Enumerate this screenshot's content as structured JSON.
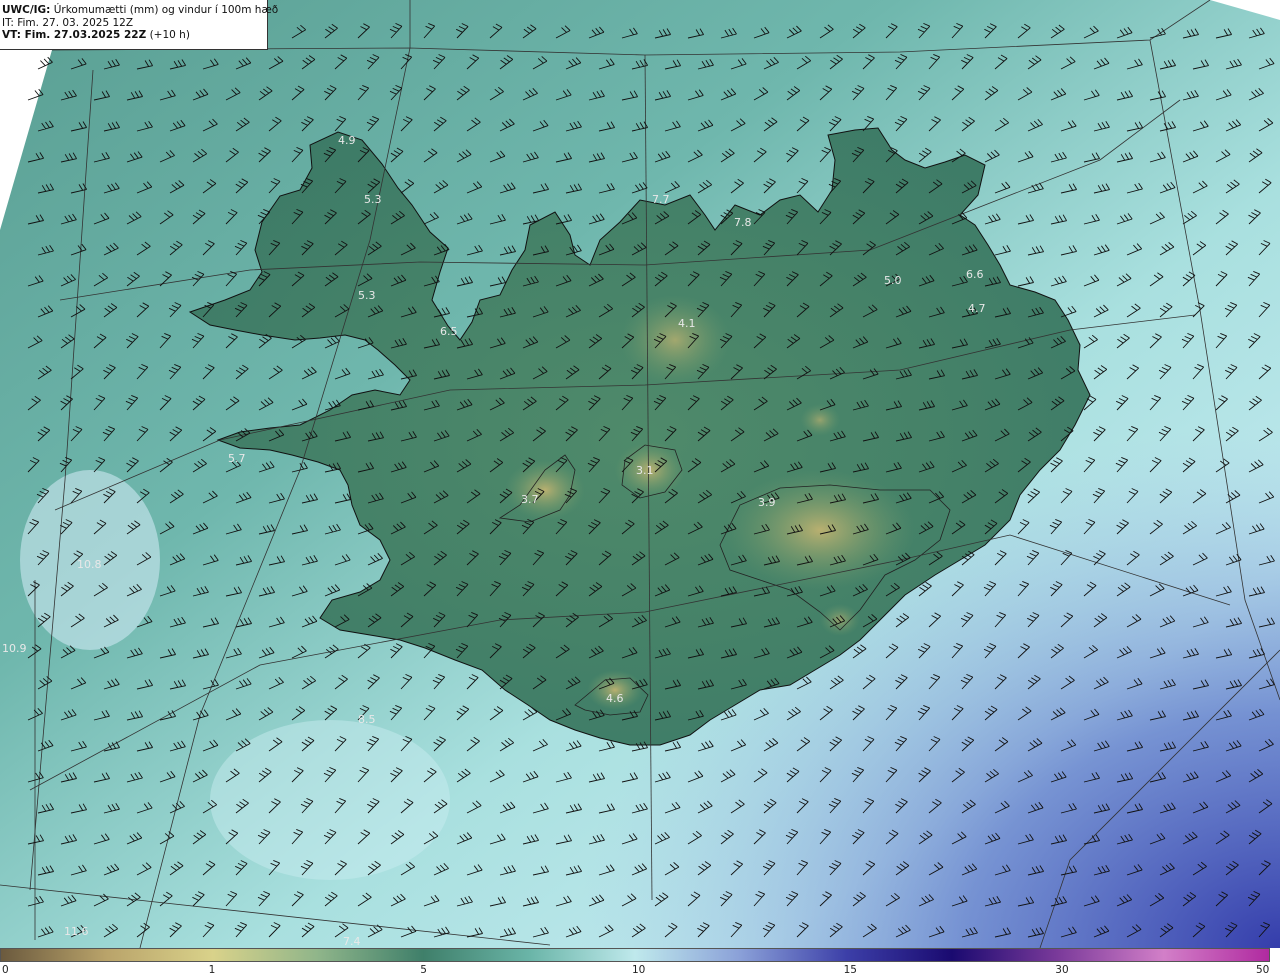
{
  "header": {
    "model_prefix": "UWC/IG:",
    "title": "Úrkomumætti (mm) og vindur í 100m hæð",
    "init_time": "IT: Fim. 27. 03. 2025 12Z",
    "valid_prefix": "VT: Fim. 27.03.2025 22Z",
    "valid_suffix": "(+10 h)"
  },
  "colorbar": {
    "ticks": [
      {
        "value": "0",
        "frac": 0.0
      },
      {
        "value": "1",
        "frac": 0.1666
      },
      {
        "value": "5",
        "frac": 0.3333
      },
      {
        "value": "10",
        "frac": 0.5
      },
      {
        "value": "15",
        "frac": 0.6666
      },
      {
        "value": "30",
        "frac": 0.8333
      },
      {
        "value": "50",
        "frac": 1.0
      }
    ],
    "colors": [
      "#6b5a3e",
      "#b9a36a",
      "#d9d28a",
      "#8fb58a",
      "#3f7f6a",
      "#6ab5a8",
      "#bfe9ec",
      "#8aa0d8",
      "#3c3fa8",
      "#1a0a70",
      "#7a3a9a",
      "#d27fc8",
      "#b02aa0"
    ]
  },
  "map_labels": [
    {
      "text": "4.9"
    },
    {
      "text": "5.3"
    },
    {
      "text": "5.3"
    },
    {
      "text": "6.5"
    },
    {
      "text": "5.7"
    },
    {
      "text": "7.7"
    },
    {
      "text": "7.8"
    },
    {
      "text": "4.1"
    },
    {
      "text": "5.0"
    },
    {
      "text": "6.6"
    },
    {
      "text": "4.7"
    },
    {
      "text": "3.1"
    },
    {
      "text": "3.7"
    },
    {
      "text": "3.9"
    },
    {
      "text": "4.6"
    },
    {
      "text": "10.8"
    },
    {
      "text": "10.9"
    },
    {
      "text": "8.5"
    },
    {
      "text": "11.6"
    },
    {
      "text": "7.4"
    }
  ]
}
